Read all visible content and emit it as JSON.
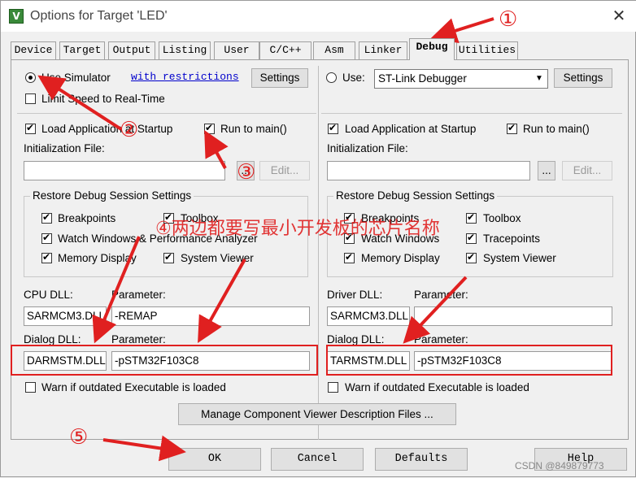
{
  "window": {
    "title": "Options for Target 'LED'",
    "close_glyph": "✕",
    "icon": "keil-uvision-icon"
  },
  "tabs": [
    "Device",
    "Target",
    "Output",
    "Listing",
    "User",
    "C/C++",
    "Asm",
    "Linker",
    "Debug",
    "Utilities"
  ],
  "active_tab": "Debug",
  "left": {
    "use_simulator_label": "Use Simulator",
    "restrictions_link": "with restrictions",
    "settings_label": "Settings",
    "limit_speed_label": "Limit Speed to Real-Time",
    "load_app_label": "Load Application at Startup",
    "run_to_main_label": "Run to main()",
    "init_file_label": "Initialization File:",
    "init_file_value": "",
    "browse_label": "...",
    "edit_label": "Edit...",
    "restore_group_title": "Restore Debug Session Settings",
    "breakpoints_label": "Breakpoints",
    "toolbox_label": "Toolbox",
    "watch_label": "Watch Windows & Performance Analyzer",
    "memory_label": "Memory Display",
    "sysviewer_label": "System Viewer",
    "cpu_dll_label": "CPU DLL:",
    "cpu_param_label": "Parameter:",
    "cpu_dll_value": "SARMCM3.DLL",
    "cpu_param_value": "-REMAP",
    "dialog_dll_label": "Dialog DLL:",
    "dialog_param_label": "Parameter:",
    "dialog_dll_value": "DARMSTM.DLL",
    "dialog_param_value": "-pSTM32F103C8",
    "warn_label": "Warn if outdated Executable is loaded"
  },
  "right": {
    "use_label": "Use:",
    "debugger_value": "ST-Link Debugger",
    "settings_label": "Settings",
    "load_app_label": "Load Application at Startup",
    "run_to_main_label": "Run to main()",
    "init_file_label": "Initialization File:",
    "init_file_value": "",
    "browse_label": "...",
    "edit_label": "Edit...",
    "restore_group_title": "Restore Debug Session Settings",
    "breakpoints_label": "Breakpoints",
    "toolbox_label": "Toolbox",
    "watch_label": "Watch Windows",
    "tracepoints_label": "Tracepoints",
    "memory_label": "Memory Display",
    "sysviewer_label": "System Viewer",
    "driver_dll_label": "Driver DLL:",
    "driver_param_label": "Parameter:",
    "driver_dll_value": "SARMCM3.DLL",
    "driver_param_value": "",
    "dialog_dll_label": "Dialog DLL:",
    "dialog_param_label": "Parameter:",
    "dialog_dll_value": "TARMSTM.DLL",
    "dialog_param_value": "-pSTM32F103C8",
    "warn_label": "Warn if outdated Executable is loaded"
  },
  "manage_button": "Manage Component Viewer Description Files ...",
  "footer": {
    "ok": "OK",
    "cancel": "Cancel",
    "defaults": "Defaults",
    "help": "Help"
  },
  "annotations": {
    "a1": "①",
    "a2": "②",
    "a3": "③",
    "a5": "⑤",
    "a4_text": "④两边都要写最小开发板的芯片名称",
    "color": "#e02020"
  },
  "watermark": "CSDN @849879773"
}
